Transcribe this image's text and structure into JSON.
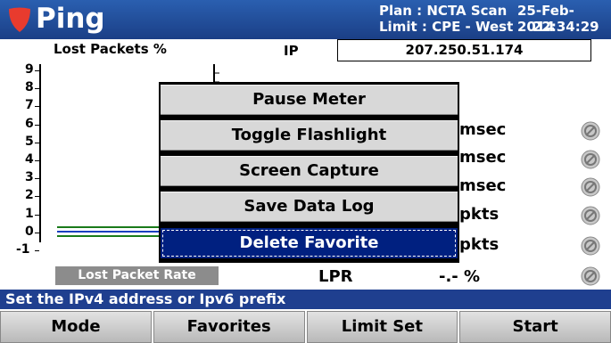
{
  "header": {
    "title": "Ping",
    "plan": "Plan : NCTA Scan",
    "limit": "Limit : CPE - West",
    "date": "25-Feb-2014",
    "time": "22:34:29",
    "icon": "shield-icon"
  },
  "chart": {
    "title": "Lost Packets %",
    "ticks": [
      "9",
      "8",
      "7",
      "6",
      "5",
      "4",
      "3",
      "2",
      "1",
      "0",
      "-1"
    ],
    "footer": "Lost Packet Rate"
  },
  "chart_data": {
    "type": "line",
    "title": "Lost Packets %",
    "ylim": [
      -1,
      9
    ],
    "series": [
      {
        "color": "#1a7a1a",
        "value": 0.35
      },
      {
        "color": "#1a3fbf",
        "value": 0.1
      },
      {
        "color": "#1a7a1a",
        "value": -0.15
      }
    ]
  },
  "ip": {
    "label": "IP",
    "value": "207.250.51.174"
  },
  "measurements": [
    {
      "unit": "msec",
      "status_icon": "na-icon"
    },
    {
      "unit": "msec",
      "status_icon": "na-icon"
    },
    {
      "unit": "msec",
      "status_icon": "na-icon"
    },
    {
      "unit": "pkts",
      "status_icon": "na-icon"
    },
    {
      "unit": "pkts",
      "status_icon": "na-icon"
    }
  ],
  "lpr": {
    "label": "LPR",
    "value": "-.- %"
  },
  "menu": {
    "items": [
      "Pause Meter",
      "Toggle Flashlight",
      "Screen Capture",
      "Save Data Log",
      "Delete Favorite"
    ],
    "selected_index": 4
  },
  "status": "Set the IPv4 address or Ipv6 prefix",
  "softkeys": [
    "Mode",
    "Favorites",
    "Limit Set",
    "Start"
  ],
  "colors": {
    "header": "#1b3f86",
    "menu_selected": "#002080",
    "shield": "#e83b2e"
  }
}
